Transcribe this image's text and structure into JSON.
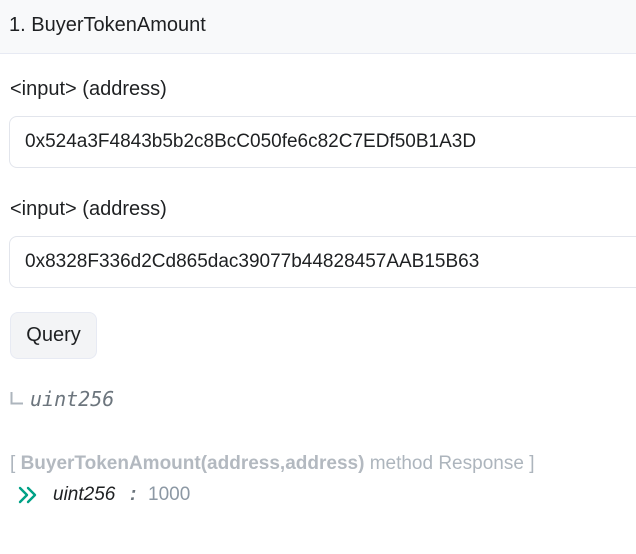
{
  "header": {
    "title": "1. BuyerTokenAmount"
  },
  "inputs": [
    {
      "label": "<input> (address)",
      "value": "0x524a3F4843b5b2c8BcC050fe6c82C7EDf50B1A3D"
    },
    {
      "label": "<input> (address)",
      "value": "0x8328F336d2Cd865dac39077b44828457AAB15B63"
    }
  ],
  "query_button": {
    "label": "Query"
  },
  "return_type": {
    "icon": "corner-down-right-icon",
    "type": "uint256"
  },
  "response": {
    "open_bracket": "[",
    "function_signature": "BuyerTokenAmount(address,address)",
    "suffix": "method Response",
    "close_bracket": "]",
    "icon": "double-chevron-right-icon",
    "result_type": "uint256",
    "separator": ":",
    "result_value": "1000"
  },
  "colors": {
    "accent": "#00a186",
    "muted": "#adb5bd",
    "text": "#1e2022"
  }
}
